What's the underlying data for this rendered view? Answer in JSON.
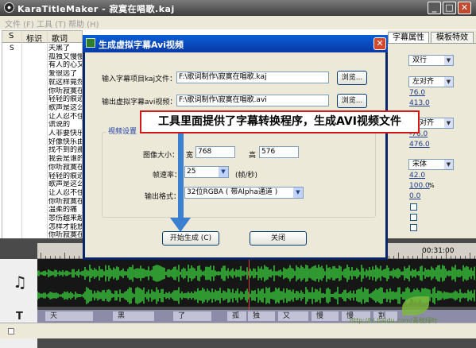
{
  "window": {
    "title": "KaraTitleMaker - 寂寞在唱歌.kaj"
  },
  "menu": [
    "文件 (F)",
    "工具 (T)",
    "帮助 (H)"
  ],
  "list": {
    "headers": [
      "S",
      "标识",
      "歌词"
    ],
    "first_row_mark": "S",
    "lyrics": [
      "天黑了",
      "孤独又慢慢",
      "有人的心又",
      "爱很远了",
      "就这样竟然",
      "你听寂寞在",
      "轻轻的痕迹",
      "歌声是这么",
      "让人忍不住",
      "谎说的",
      "人非要快乐",
      "好像快乐由",
      "找不到的那",
      "我会是谁的",
      "你听寂寞在",
      "轻轻的痕迹",
      "歌声是这么",
      "让人忍不住",
      "你听寂寞在",
      "温柔的痛",
      "悲伤越来越",
      "怎样才能放",
      "你听寂寞在",
      "轻轻的痕迹"
    ]
  },
  "right_panel": {
    "tabs": [
      "字幕属性",
      "模板特效"
    ],
    "layout_select": "双行",
    "align_select": "左对齐",
    "val1": "76.0",
    "val2": "413.0",
    "align_select2": "右对齐",
    "val3": "-76.0",
    "val4": "476.0",
    "font_select": "宋体",
    "size": "42.0",
    "percent": "100.0",
    "percent_unit": "%",
    "zero": "0.0"
  },
  "timeline": {
    "time_label": "00:31:00"
  },
  "subtitle_blocks": [
    "天",
    "黑",
    "了",
    "孤",
    "独",
    "又",
    "慢",
    "慢",
    "割"
  ],
  "watermark": "http://hi.baidu.com/青枝绿叶",
  "dialog": {
    "title": "生成虚拟字幕Avi视频",
    "input_label": "输入字幕项目kaj文件：",
    "input_value": "F:\\歌词制作\\寂寞在唱歌.kaj",
    "browse1": "浏览...",
    "output_label": "输出虚拟字幕avi视频：",
    "output_value": "F:\\歌词制作\\寂寞在唱歌.avi",
    "browse2": "浏览...",
    "group_label": "视频设置",
    "size_label": "图像大小：",
    "width_label": "宽",
    "width_value": "768",
    "height_label": "高",
    "height_value": "576",
    "fps_label": "帧速率：",
    "fps_value": "25",
    "fps_unit": "(帧/秒)",
    "format_label": "输出格式：",
    "format_value": "32位RGBA ( 带Alpha通道 )",
    "start_button": "开始生成 (C)",
    "close_button": "关闭"
  },
  "callout": "工具里面提供了字幕转换程序，生成AVI视频文件",
  "colors": {
    "accent": "#0a5fd7",
    "callout_border": "#d21818",
    "waveform": "#39c339",
    "arrow": "#3b7fd0"
  }
}
